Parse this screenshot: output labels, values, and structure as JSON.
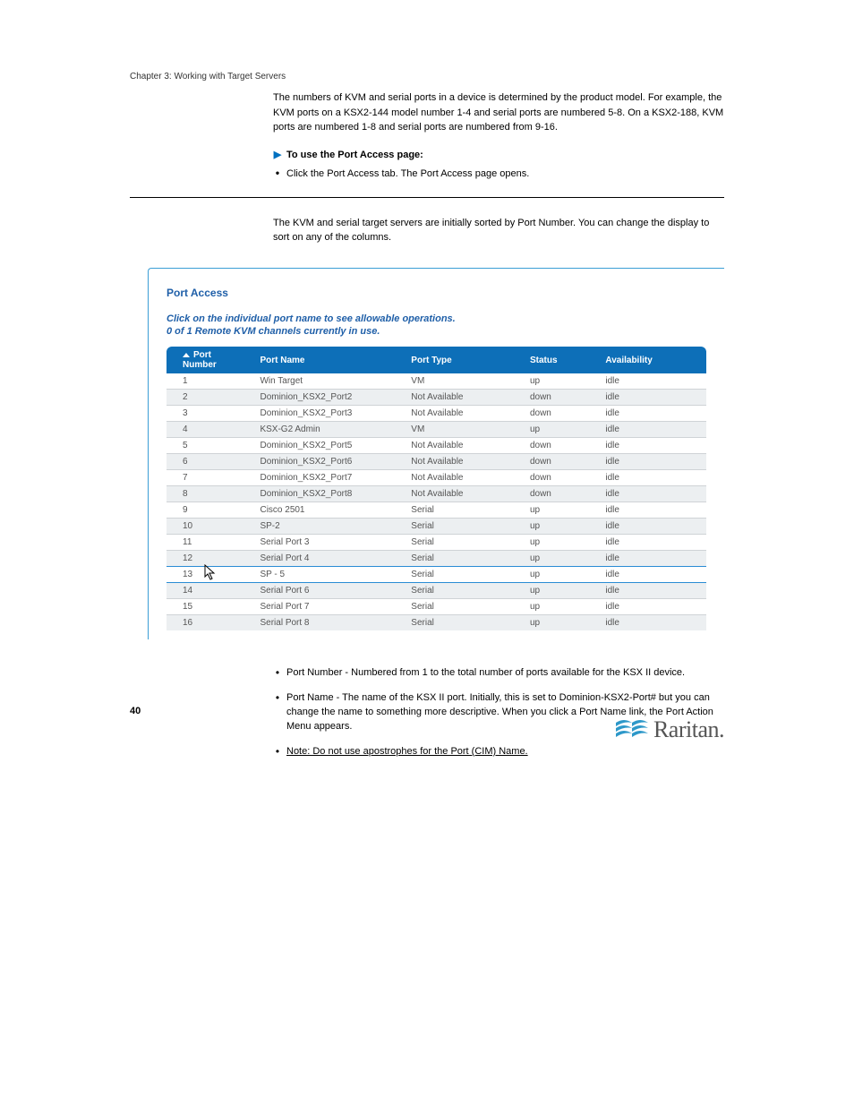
{
  "header": {
    "chapter": "Chapter 3: Working with Target Servers"
  },
  "intro": {
    "p1": "The numbers of KVM and serial ports in a device is determined by the product model. For example, the KVM ports on a KSX2-144 model number 1-4 and serial ports are numbered 5-8. On a KSX2-188, KVM ports are numbered 1-8 and serial ports are numbered from 9-16."
  },
  "instructHead": "To use the Port Access page:",
  "instructBullet": "Click the Port Access tab. The Port Access page opens.",
  "afterRule": "The KVM and serial target servers are initially sorted by Port Number. You can change the display to sort on any of the columns.",
  "panel": {
    "title": "Port Access",
    "sub1": "Click on the individual port name to see allowable operations.",
    "sub2": "0 of 1 Remote KVM channels currently in use.",
    "headers": {
      "num": "Port Number",
      "name": "Port Name",
      "type": "Port Type",
      "status": "Status",
      "avail": "Availability"
    },
    "rows": [
      {
        "n": "1",
        "name": "Win Target",
        "type": "VM",
        "status": "up",
        "avail": "idle",
        "link": true,
        "even": false,
        "hl": false
      },
      {
        "n": "2",
        "name": "Dominion_KSX2_Port2",
        "type": "Not Available",
        "status": "down",
        "avail": "idle",
        "link": false,
        "even": true,
        "hl": false
      },
      {
        "n": "3",
        "name": "Dominion_KSX2_Port3",
        "type": "Not Available",
        "status": "down",
        "avail": "idle",
        "link": false,
        "even": false,
        "hl": false
      },
      {
        "n": "4",
        "name": "KSX-G2 Admin",
        "type": "VM",
        "status": "up",
        "avail": "idle",
        "link": true,
        "even": true,
        "hl": false
      },
      {
        "n": "5",
        "name": "Dominion_KSX2_Port5",
        "type": "Not Available",
        "status": "down",
        "avail": "idle",
        "link": false,
        "even": false,
        "hl": false
      },
      {
        "n": "6",
        "name": "Dominion_KSX2_Port6",
        "type": "Not Available",
        "status": "down",
        "avail": "idle",
        "link": false,
        "even": true,
        "hl": false
      },
      {
        "n": "7",
        "name": "Dominion_KSX2_Port7",
        "type": "Not Available",
        "status": "down",
        "avail": "idle",
        "link": false,
        "even": false,
        "hl": false
      },
      {
        "n": "8",
        "name": "Dominion_KSX2_Port8",
        "type": "Not Available",
        "status": "down",
        "avail": "idle",
        "link": false,
        "even": true,
        "hl": false
      },
      {
        "n": "9",
        "name": "Cisco 2501",
        "type": "Serial",
        "status": "up",
        "avail": "idle",
        "link": true,
        "even": false,
        "hl": false
      },
      {
        "n": "10",
        "name": "SP-2",
        "type": "Serial",
        "status": "up",
        "avail": "idle",
        "link": true,
        "even": true,
        "hl": false
      },
      {
        "n": "11",
        "name": "Serial Port 3",
        "type": "Serial",
        "status": "up",
        "avail": "idle",
        "link": true,
        "even": false,
        "hl": false
      },
      {
        "n": "12",
        "name": "Serial Port 4",
        "type": "Serial",
        "status": "up",
        "avail": "idle",
        "link": true,
        "even": true,
        "hl": true
      },
      {
        "n": "13",
        "name": "SP - 5",
        "type": "Serial",
        "status": "up",
        "avail": "idle",
        "link": true,
        "even": false,
        "hl": true,
        "cursor": true
      },
      {
        "n": "14",
        "name": "Serial Port 6",
        "type": "Serial",
        "status": "up",
        "avail": "idle",
        "link": true,
        "even": true,
        "hl": false
      },
      {
        "n": "15",
        "name": "Serial Port 7",
        "type": "Serial",
        "status": "up",
        "avail": "idle",
        "link": true,
        "even": false,
        "hl": false
      },
      {
        "n": "16",
        "name": "Serial Port 8",
        "type": "Serial",
        "status": "up",
        "avail": "idle",
        "link": true,
        "even": true,
        "hl": false
      }
    ]
  },
  "bullets": [
    {
      "text": "Port Number - Numbered from 1 to the total number of ports available for the KSX II device.",
      "ul": false
    },
    {
      "text": "Port Name - The name of the KSX II port. Initially, this is set to Dominion-KSX2-Port# but you can change the name to something more descriptive. When you click a Port Name link, the Port Action Menu appears.",
      "ul": false
    },
    {
      "text": "Note: Do not use apostrophes for the Port (CIM) Name.",
      "ul": true
    }
  ],
  "page_num": "40",
  "logo_text": "Raritan."
}
